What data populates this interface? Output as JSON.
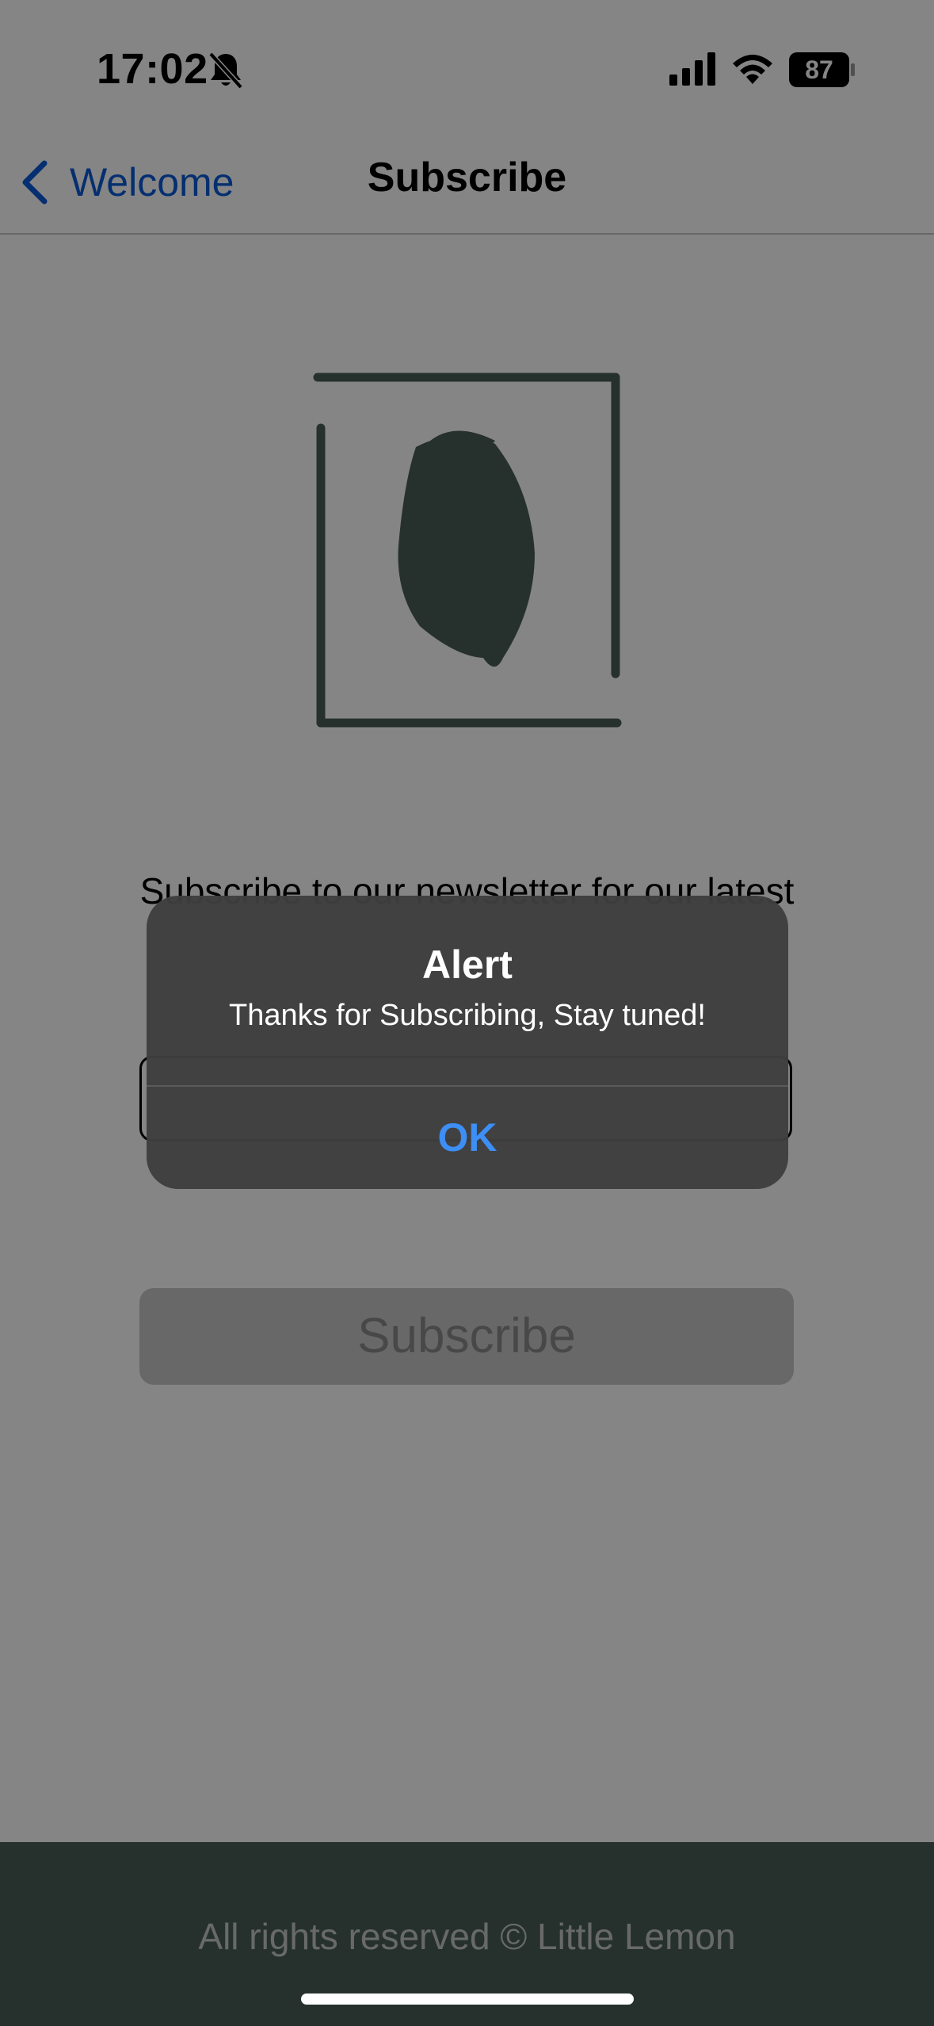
{
  "status_bar": {
    "time": "17:02",
    "battery": "87"
  },
  "nav": {
    "back_label": "Welcome",
    "title": "Subscribe"
  },
  "main": {
    "description": "Subscribe to our newsletter for our latest",
    "subscribe_label": "Subscribe"
  },
  "footer": {
    "text": "All rights reserved © Little Lemon"
  },
  "alert": {
    "title": "Alert",
    "message": "Thanks for Subscribing, Stay tuned!",
    "ok_label": "OK"
  },
  "colors": {
    "accent": "#0a5bd6",
    "brand_dark": "#495e57",
    "alert_button": "#3d8ef5"
  },
  "icons": [
    "bell-slash-icon",
    "cellular-signal-icon",
    "wifi-icon",
    "battery-icon",
    "chevron-left-icon",
    "little-lemon-logo"
  ]
}
